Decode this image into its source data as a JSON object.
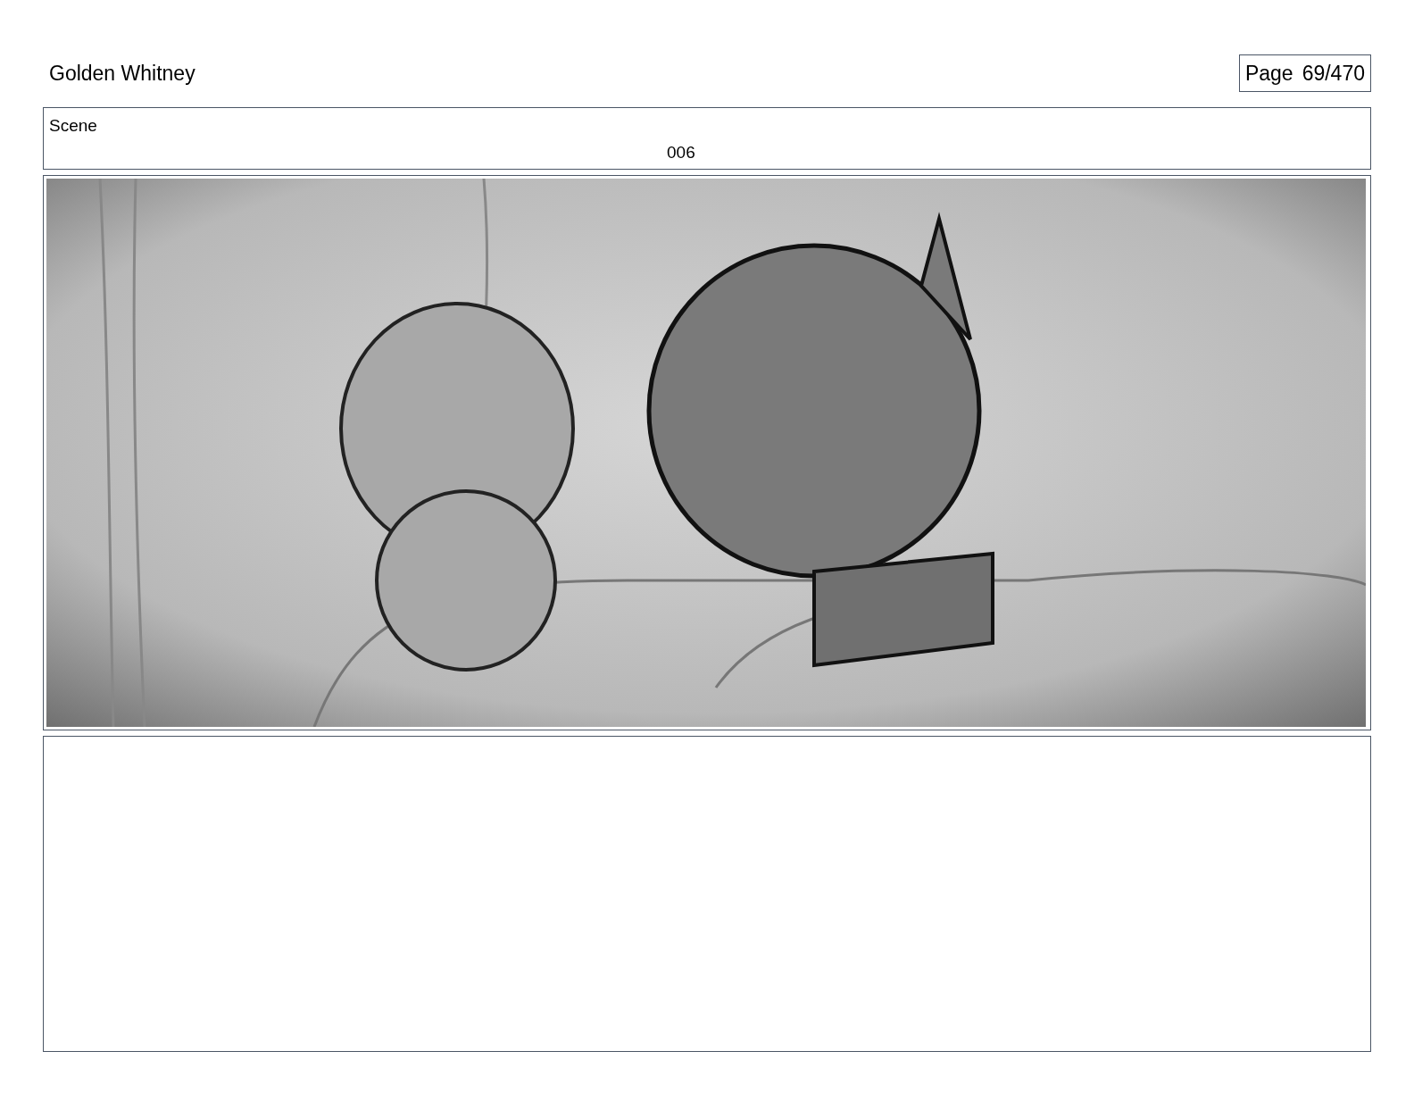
{
  "header": {
    "title": "Golden Whitney",
    "page_label": "Page",
    "page_number": "69/470"
  },
  "scene": {
    "label": "Scene",
    "number": "006"
  }
}
